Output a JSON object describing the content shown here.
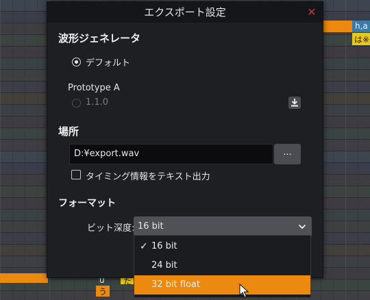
{
  "dialog": {
    "title": "エクスポート設定",
    "close_glyph": "✕",
    "waveform_section": {
      "heading": "波形ジェネレータ",
      "default_option": "デフォルト",
      "plugin_name": "Prototype A",
      "plugin_version": "1.1.0",
      "download_icon": "download-icon"
    },
    "location_section": {
      "heading": "場所",
      "path_value": "D:¥export.wav",
      "browse_label": "...",
      "timing_checkbox_label": "タイミング情報をテキスト出力",
      "timing_checked": false
    },
    "format_section": {
      "heading": "フォーマット",
      "bitdepth_label": "ビット深度:",
      "bitdepth_value": "16 bit",
      "chevron_icon": "chevron-down-icon",
      "options": [
        {
          "label": "16 bit",
          "check": "✓"
        },
        {
          "label": "24 bit",
          "check": ""
        },
        {
          "label": "32 bit float",
          "check": ""
        }
      ],
      "checked_option": "16 bit",
      "hovered_option": "32 bit float"
    }
  },
  "background": {
    "top_right_lyric_1": "h,a",
    "top_right_lyric_2": "は※",
    "bottom_lyric_phoneme": "u",
    "bottom_lyric_kana": "う",
    "bottom_lyric_partial": "た"
  },
  "colors": {
    "accent": "#ec8a10",
    "note_yellow": "#e8c820",
    "dialog_bg": "#1e1f22",
    "close_red": "#c23a3a"
  }
}
